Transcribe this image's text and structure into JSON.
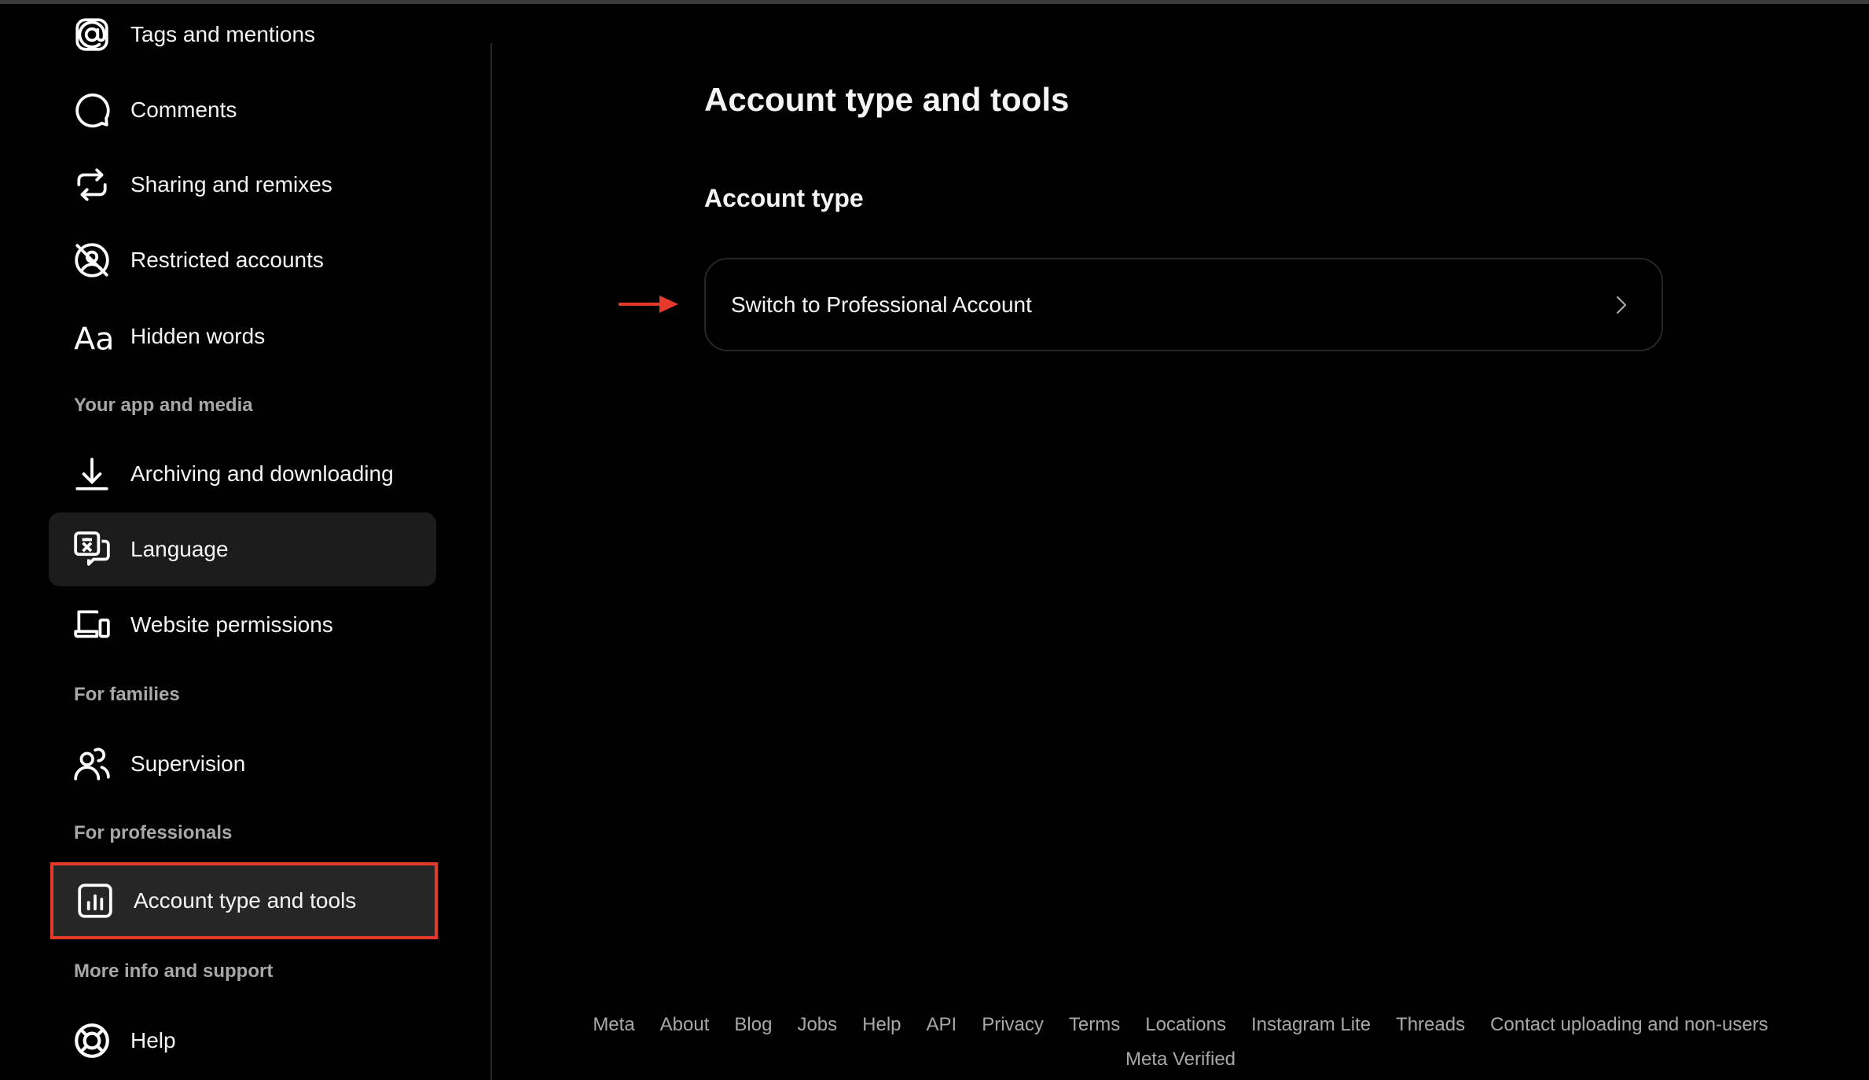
{
  "sidebar": {
    "items": [
      {
        "label": "Tags and mentions",
        "icon": "at-sign-icon"
      },
      {
        "label": "Comments",
        "icon": "comment-icon"
      },
      {
        "label": "Sharing and remixes",
        "icon": "repost-icon"
      },
      {
        "label": "Restricted accounts",
        "icon": "restricted-icon"
      },
      {
        "label": "Hidden words",
        "icon": "text-aa-icon"
      },
      {
        "label": "Archiving and downloading",
        "icon": "download-icon"
      },
      {
        "label": "Language",
        "icon": "translate-icon"
      },
      {
        "label": "Website permissions",
        "icon": "devices-icon"
      },
      {
        "label": "Supervision",
        "icon": "people-icon"
      },
      {
        "label": "Account type and tools",
        "icon": "chart-icon"
      },
      {
        "label": "Help",
        "icon": "lifebuoy-icon"
      }
    ],
    "headers": [
      "Your app and media",
      "For families",
      "For professionals",
      "More info and support"
    ],
    "active_item": "Account type and tools",
    "highlight_color": "#e5392a"
  },
  "main": {
    "title": "Account type and tools",
    "section_title": "Account type",
    "switch_button_label": "Switch to Professional Account",
    "annotation_arrow_color": "#e5392a"
  },
  "footer": {
    "links": [
      "Meta",
      "About",
      "Blog",
      "Jobs",
      "Help",
      "API",
      "Privacy",
      "Terms",
      "Locations",
      "Instagram Lite",
      "Threads",
      "Contact uploading and non-users"
    ],
    "second_row": [
      "Meta Verified"
    ]
  }
}
